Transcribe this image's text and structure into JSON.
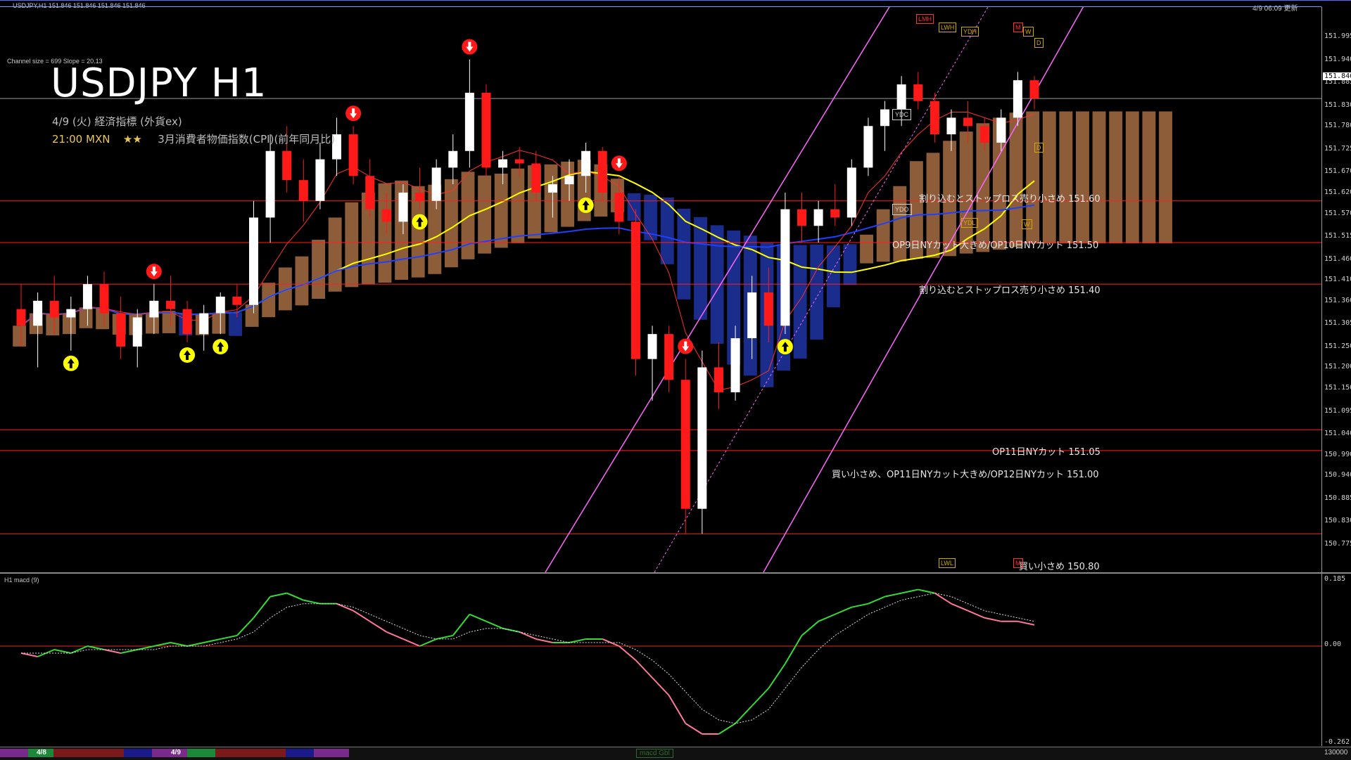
{
  "window": {
    "header_info": "USDJPY,H1  151.846 151.846 151.846 151.846",
    "header_right": "4/9 06:09 更新",
    "channel_info": "Channel size = 699 Slope = 20.13"
  },
  "title": {
    "main": "USDJPY H1",
    "line1": "4/9 (火) 経済指標 (外貨ex)",
    "line2_time": "21:00 MXN",
    "line2_stars": "★★",
    "line2_event": "3月消費者物価指数(CPI)(前年同月比)"
  },
  "colors": {
    "background": "#000000",
    "bull_candle": "#ffffff",
    "bear_candle": "#ff1a1a",
    "level_line": "#ff2020",
    "channel": "#ff66ff",
    "ma_yellow": "#ffff00",
    "ma_blue": "#2040ff",
    "ichimoku_cloud_bull": "#ffaa66",
    "ichimoku_cloud_bear": "#3050ff",
    "macd_up": "#33dd33",
    "macd_down": "#ff7799"
  },
  "price_axis": {
    "ticks": [
      "151.995",
      "151.940",
      "151.885",
      "151.830",
      "151.780",
      "151.725",
      "151.670",
      "151.620",
      "151.570",
      "151.515",
      "151.460",
      "151.410",
      "151.360",
      "151.305",
      "151.250",
      "151.200",
      "151.150",
      "151.095",
      "151.040",
      "150.990",
      "150.940",
      "150.885",
      "150.830",
      "150.775"
    ],
    "current_price": "151.846"
  },
  "levels": [
    {
      "text": "割り込むとストップロス売り小さめ 151.60",
      "price": 151.6
    },
    {
      "text": "OP9日NYカット大きめ/OP10日NYカット 151.50",
      "price": 151.5
    },
    {
      "text": "割り込むとストップロス売り小さめ 151.40",
      "price": 151.4
    },
    {
      "text": "OP11日NYカット 151.05",
      "price": 151.05
    },
    {
      "text": "買い小さめ、OP11日NYカット大きめ/OP12日NYカット 151.00",
      "price": 151.0
    },
    {
      "text": "買い小さめ 150.80",
      "price": 150.8
    }
  ],
  "tags": {
    "lmh": "LMH",
    "lwh": "LWH",
    "ydh": "YDH",
    "m": "M",
    "w": "W",
    "d": "D",
    "ydc": "YDC",
    "ydo": "YDO",
    "ydl": "YDL",
    "lwl": "LWL"
  },
  "macd": {
    "label": "H1  macd (9)",
    "ticks": [
      "0.185",
      "0.00",
      "-0.262"
    ],
    "bottom_right": "130000"
  },
  "time_axis": {
    "labels": [
      "4/8",
      "4/9"
    ],
    "status": "macd Gbl"
  },
  "chart_data": {
    "type": "candlestick",
    "title": "USDJPY H1",
    "ylim": [
      150.775,
      151.995
    ],
    "ohlc": [
      {
        "o": 151.34,
        "h": 151.4,
        "l": 151.25,
        "c": 151.3
      },
      {
        "o": 151.3,
        "h": 151.38,
        "l": 151.2,
        "c": 151.36
      },
      {
        "o": 151.36,
        "h": 151.42,
        "l": 151.28,
        "c": 151.32
      },
      {
        "o": 151.32,
        "h": 151.37,
        "l": 151.24,
        "c": 151.34
      },
      {
        "o": 151.34,
        "h": 151.42,
        "l": 151.3,
        "c": 151.4
      },
      {
        "o": 151.4,
        "h": 151.43,
        "l": 151.3,
        "c": 151.33
      },
      {
        "o": 151.33,
        "h": 151.37,
        "l": 151.22,
        "c": 151.25
      },
      {
        "o": 151.25,
        "h": 151.34,
        "l": 151.2,
        "c": 151.32
      },
      {
        "o": 151.32,
        "h": 151.4,
        "l": 151.28,
        "c": 151.36
      },
      {
        "o": 151.36,
        "h": 151.42,
        "l": 151.3,
        "c": 151.34
      },
      {
        "o": 151.34,
        "h": 151.36,
        "l": 151.26,
        "c": 151.28
      },
      {
        "o": 151.28,
        "h": 151.35,
        "l": 151.24,
        "c": 151.33
      },
      {
        "o": 151.33,
        "h": 151.38,
        "l": 151.28,
        "c": 151.37
      },
      {
        "o": 151.37,
        "h": 151.4,
        "l": 151.32,
        "c": 151.35
      },
      {
        "o": 151.35,
        "h": 151.6,
        "l": 151.33,
        "c": 151.56
      },
      {
        "o": 151.56,
        "h": 151.76,
        "l": 151.5,
        "c": 151.72
      },
      {
        "o": 151.72,
        "h": 151.78,
        "l": 151.62,
        "c": 151.65
      },
      {
        "o": 151.65,
        "h": 151.7,
        "l": 151.55,
        "c": 151.6
      },
      {
        "o": 151.6,
        "h": 151.74,
        "l": 151.58,
        "c": 151.7
      },
      {
        "o": 151.7,
        "h": 151.8,
        "l": 151.66,
        "c": 151.76
      },
      {
        "o": 151.76,
        "h": 151.78,
        "l": 151.64,
        "c": 151.66
      },
      {
        "o": 151.66,
        "h": 151.7,
        "l": 151.56,
        "c": 151.58
      },
      {
        "o": 151.58,
        "h": 151.62,
        "l": 151.52,
        "c": 151.55
      },
      {
        "o": 151.55,
        "h": 151.64,
        "l": 151.52,
        "c": 151.62
      },
      {
        "o": 151.62,
        "h": 151.68,
        "l": 151.58,
        "c": 151.6
      },
      {
        "o": 151.6,
        "h": 151.7,
        "l": 151.58,
        "c": 151.68
      },
      {
        "o": 151.68,
        "h": 151.76,
        "l": 151.64,
        "c": 151.72
      },
      {
        "o": 151.72,
        "h": 151.94,
        "l": 151.68,
        "c": 151.86
      },
      {
        "o": 151.86,
        "h": 151.88,
        "l": 151.66,
        "c": 151.68
      },
      {
        "o": 151.68,
        "h": 151.72,
        "l": 151.64,
        "c": 151.7
      },
      {
        "o": 151.7,
        "h": 151.73,
        "l": 151.66,
        "c": 151.69
      },
      {
        "o": 151.69,
        "h": 151.72,
        "l": 151.6,
        "c": 151.62
      },
      {
        "o": 151.62,
        "h": 151.66,
        "l": 151.56,
        "c": 151.64
      },
      {
        "o": 151.64,
        "h": 151.7,
        "l": 151.6,
        "c": 151.66
      },
      {
        "o": 151.66,
        "h": 151.74,
        "l": 151.62,
        "c": 151.72
      },
      {
        "o": 151.72,
        "h": 151.73,
        "l": 151.6,
        "c": 151.62
      },
      {
        "o": 151.62,
        "h": 151.66,
        "l": 151.52,
        "c": 151.55
      },
      {
        "o": 151.55,
        "h": 151.58,
        "l": 151.18,
        "c": 151.22
      },
      {
        "o": 151.22,
        "h": 151.3,
        "l": 151.12,
        "c": 151.28
      },
      {
        "o": 151.28,
        "h": 151.3,
        "l": 151.14,
        "c": 151.17
      },
      {
        "o": 151.17,
        "h": 151.22,
        "l": 150.8,
        "c": 150.86
      },
      {
        "o": 150.86,
        "h": 151.24,
        "l": 150.8,
        "c": 151.2
      },
      {
        "o": 151.2,
        "h": 151.26,
        "l": 151.1,
        "c": 151.14
      },
      {
        "o": 151.14,
        "h": 151.3,
        "l": 151.12,
        "c": 151.27
      },
      {
        "o": 151.27,
        "h": 151.42,
        "l": 151.22,
        "c": 151.38
      },
      {
        "o": 151.38,
        "h": 151.44,
        "l": 151.26,
        "c": 151.3
      },
      {
        "o": 151.3,
        "h": 151.62,
        "l": 151.28,
        "c": 151.58
      },
      {
        "o": 151.58,
        "h": 151.62,
        "l": 151.5,
        "c": 151.54
      },
      {
        "o": 151.54,
        "h": 151.6,
        "l": 151.5,
        "c": 151.58
      },
      {
        "o": 151.58,
        "h": 151.64,
        "l": 151.54,
        "c": 151.56
      },
      {
        "o": 151.56,
        "h": 151.7,
        "l": 151.54,
        "c": 151.68
      },
      {
        "o": 151.68,
        "h": 151.8,
        "l": 151.66,
        "c": 151.78
      },
      {
        "o": 151.78,
        "h": 151.84,
        "l": 151.72,
        "c": 151.82
      },
      {
        "o": 151.82,
        "h": 151.9,
        "l": 151.78,
        "c": 151.88
      },
      {
        "o": 151.88,
        "h": 151.91,
        "l": 151.82,
        "c": 151.84
      },
      {
        "o": 151.84,
        "h": 151.86,
        "l": 151.74,
        "c": 151.76
      },
      {
        "o": 151.76,
        "h": 151.82,
        "l": 151.72,
        "c": 151.8
      },
      {
        "o": 151.8,
        "h": 151.84,
        "l": 151.74,
        "c": 151.78
      },
      {
        "o": 151.78,
        "h": 151.8,
        "l": 151.72,
        "c": 151.74
      },
      {
        "o": 151.74,
        "h": 151.82,
        "l": 151.72,
        "c": 151.8
      },
      {
        "o": 151.8,
        "h": 151.91,
        "l": 151.78,
        "c": 151.89
      },
      {
        "o": 151.89,
        "h": 151.9,
        "l": 151.82,
        "c": 151.846
      }
    ],
    "macd": [
      -0.02,
      -0.03,
      -0.01,
      -0.02,
      0.0,
      -0.01,
      -0.02,
      -0.01,
      0.0,
      0.01,
      0.0,
      0.01,
      0.02,
      0.03,
      0.08,
      0.14,
      0.15,
      0.13,
      0.12,
      0.12,
      0.1,
      0.07,
      0.04,
      0.02,
      0.0,
      0.02,
      0.03,
      0.09,
      0.07,
      0.05,
      0.04,
      0.02,
      0.01,
      0.01,
      0.02,
      0.02,
      0.0,
      -0.04,
      -0.09,
      -0.14,
      -0.22,
      -0.25,
      -0.25,
      -0.22,
      -0.17,
      -0.12,
      -0.05,
      0.03,
      0.07,
      0.09,
      0.11,
      0.12,
      0.14,
      0.15,
      0.16,
      0.15,
      0.12,
      0.1,
      0.08,
      0.07,
      0.07,
      0.06
    ],
    "signal": [
      -0.02,
      -0.02,
      -0.02,
      -0.02,
      -0.01,
      -0.01,
      -0.01,
      -0.01,
      -0.01,
      0.0,
      0.0,
      0.0,
      0.01,
      0.02,
      0.04,
      0.08,
      0.11,
      0.12,
      0.12,
      0.12,
      0.11,
      0.09,
      0.07,
      0.05,
      0.03,
      0.02,
      0.02,
      0.04,
      0.05,
      0.05,
      0.04,
      0.03,
      0.02,
      0.01,
      0.01,
      0.01,
      0.01,
      -0.01,
      -0.04,
      -0.08,
      -0.13,
      -0.18,
      -0.21,
      -0.22,
      -0.21,
      -0.18,
      -0.12,
      -0.06,
      -0.01,
      0.03,
      0.06,
      0.09,
      0.11,
      0.13,
      0.14,
      0.15,
      0.14,
      0.12,
      0.1,
      0.09,
      0.08,
      0.07
    ]
  }
}
